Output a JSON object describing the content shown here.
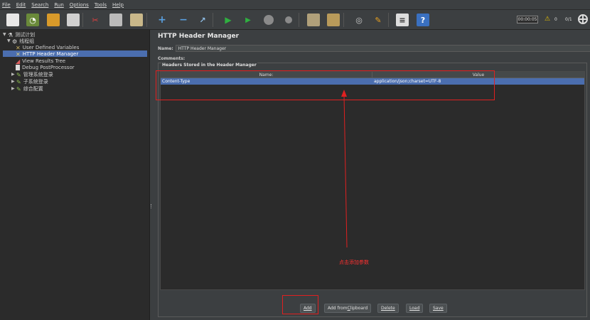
{
  "menu": {
    "items": [
      "File",
      "Edit",
      "Search",
      "Run",
      "Options",
      "Tools",
      "Help"
    ]
  },
  "toolbar": {
    "timer": "00:00:05",
    "warning_count": "0",
    "thread_count": "0/1",
    "icons": [
      "new",
      "templates",
      "open",
      "save",
      "cut",
      "copy",
      "paste",
      "expand",
      "collapse",
      "toggle",
      "start",
      "start-no-pause",
      "stop",
      "shutdown",
      "clear",
      "clear-all",
      "search",
      "reset-search",
      "function-helper",
      "help"
    ]
  },
  "tree": {
    "test_plan": "测试计划",
    "thread_group": "线程组",
    "items": [
      "User Defined Variables",
      "HTTP Header Manager",
      "View Results Tree",
      "Debug PostProcessor"
    ],
    "controllers": [
      "管理系统登录",
      "子系统登录",
      "综合配置"
    ]
  },
  "panel": {
    "title": "HTTP Header Manager",
    "name_label": "Name:",
    "name_value": "HTTP Header Manager",
    "comments_label": "Comments:",
    "group_title": "Headers Stored in the Header Manager",
    "columns": [
      "Name:",
      "Value"
    ],
    "rows": [
      {
        "name": "Content-Type",
        "value": "application/json;charset=UTF-8"
      }
    ]
  },
  "buttons": {
    "add": "Add",
    "add_clipboard_prefix": "Add from ",
    "add_clipboard_underlined": "C",
    "add_clipboard_suffix": "lipboard",
    "delete": "Delete",
    "load": "Load",
    "save": "Save"
  },
  "annotation": {
    "text": "点击添加参数",
    "color": "#e02020"
  },
  "colors": {
    "selection": "#4b6eaf",
    "background": "#3c3f41",
    "tree_bg": "#2b2b2b"
  }
}
